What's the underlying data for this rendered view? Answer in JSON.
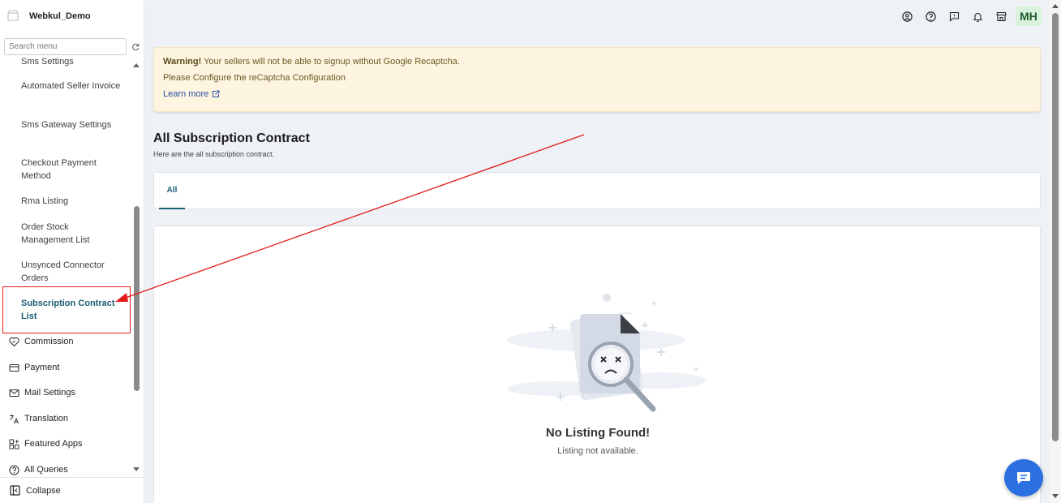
{
  "brand": {
    "name": "Webkul_Demo"
  },
  "search": {
    "placeholder": "Search menu"
  },
  "sidebar": {
    "sub_items": [
      {
        "label": "Sms Settings"
      },
      {
        "label": "Automated Seller Invoice"
      },
      {
        "label": "Sms Gateway Settings"
      },
      {
        "label": "Checkout Payment Method"
      },
      {
        "label": "Rma Listing"
      },
      {
        "label": "Order Stock Management List"
      },
      {
        "label": "Unsynced Connector Orders"
      },
      {
        "label": "Subscription Contract List"
      }
    ],
    "main_items": [
      {
        "label": "Commission",
        "icon": "commission-icon"
      },
      {
        "label": "Payment",
        "icon": "payment-card-icon"
      },
      {
        "label": "Mail Settings",
        "icon": "mail-icon"
      },
      {
        "label": "Translation",
        "icon": "translate-icon"
      },
      {
        "label": "Featured Apps",
        "icon": "apps-grid-icon"
      },
      {
        "label": "All Queries",
        "icon": "question-circle-icon"
      }
    ],
    "collapse_label": "Collapse"
  },
  "topbar": {
    "icons": [
      "account-circle-icon",
      "help-circle-icon",
      "feedback-icon",
      "bell-icon",
      "store-icon"
    ],
    "avatar_initials": "MH"
  },
  "warning": {
    "bold": "Warning!",
    "text": "Your sellers will not be able to signup without Google Recaptcha.",
    "line2": "Please Configure the reCaptcha Configuration",
    "link": "Learn more"
  },
  "page": {
    "title": "All Subscription Contract",
    "subtitle": "Here are the all subscription contract."
  },
  "tabs": [
    {
      "label": "All"
    }
  ],
  "empty": {
    "title": "No Listing Found!",
    "subtitle": "Listing not available."
  },
  "colors": {
    "accent": "#1c5d74",
    "warning_bg": "#fdf5e0",
    "annotation": "#e31b1b",
    "chat": "#2b6fe0",
    "avatar_bg": "#d9f2dc"
  }
}
